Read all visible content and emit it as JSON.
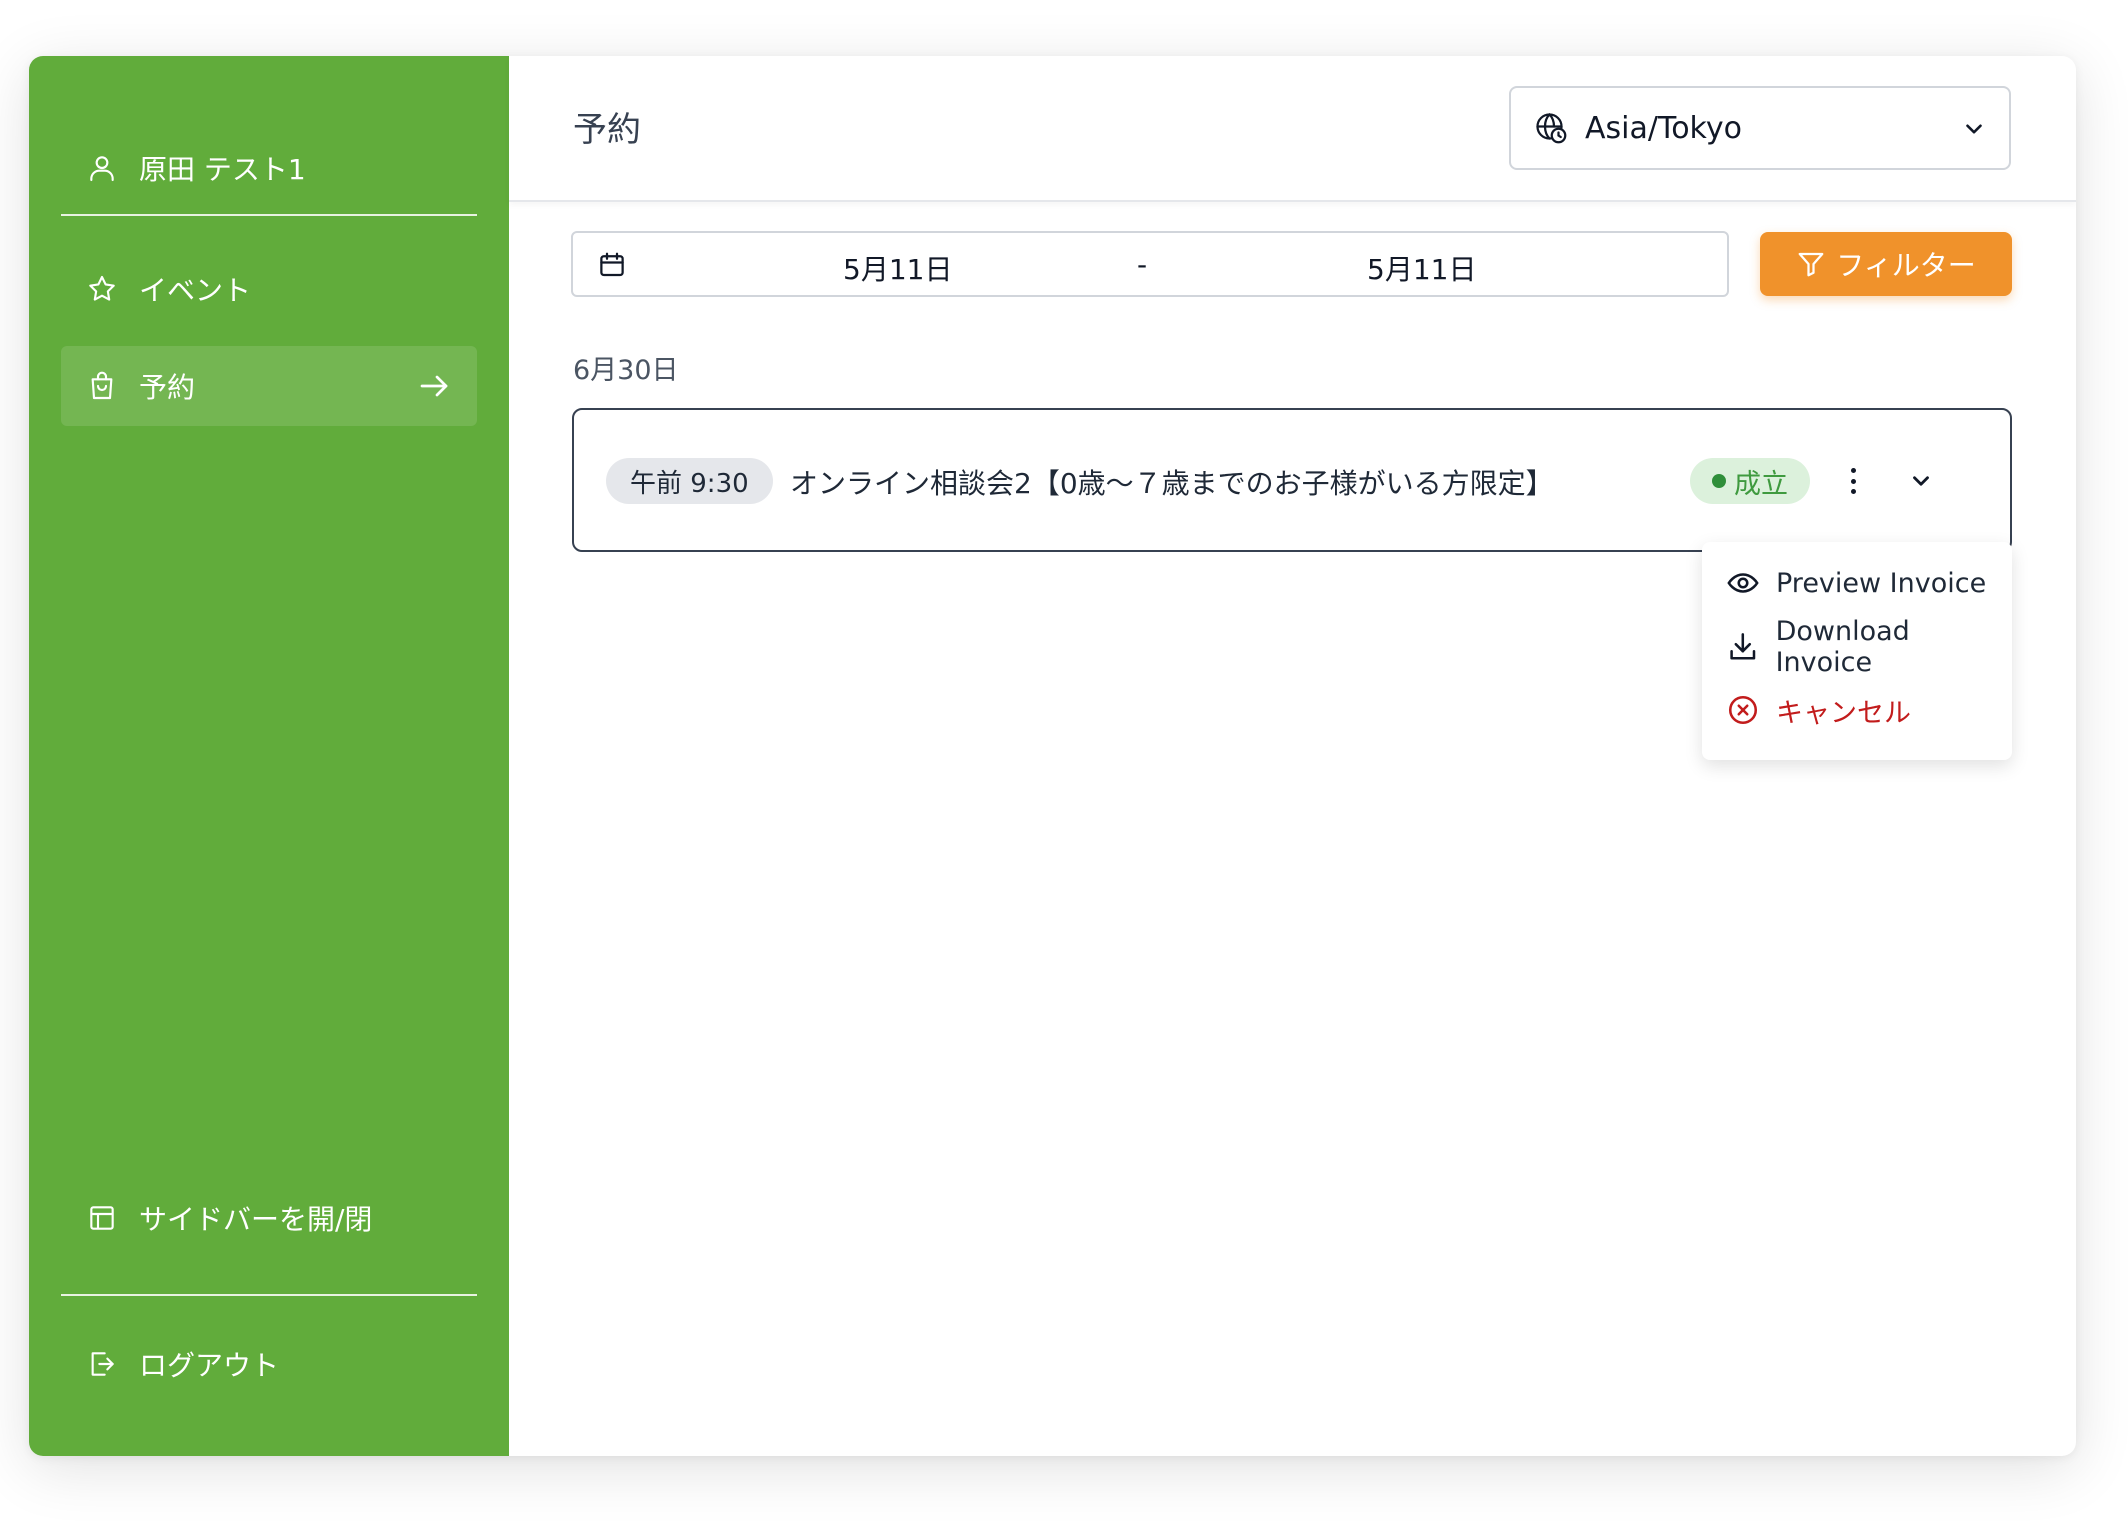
{
  "user": {
    "name": "原田 テスト1"
  },
  "sidebar": {
    "items": [
      {
        "label": "イベント",
        "icon": "star-icon"
      },
      {
        "label": "予約",
        "icon": "shopping-bag-icon",
        "active": true
      }
    ],
    "toggle_label": "サイドバーを開/閉",
    "logout_label": "ログアウト"
  },
  "header": {
    "title": "予約",
    "timezone": "Asia/Tokyo"
  },
  "filters": {
    "date_start": "5月11日",
    "date_separator": "-",
    "date_end": "5月11日",
    "filter_label": "フィルター"
  },
  "bookings": {
    "group_date": "6月30日",
    "items": [
      {
        "time": "午前 9:30",
        "title": "オンライン相談会2【0歳～７歳までのお子様がいる方限定】",
        "status": "成立"
      }
    ]
  },
  "menu": {
    "items": [
      {
        "label": "Preview Invoice",
        "icon": "eye-icon"
      },
      {
        "label": "Download Invoice",
        "icon": "download-icon"
      },
      {
        "label": "キャンセル",
        "icon": "cancel-circle-icon",
        "danger": true
      }
    ]
  },
  "colors": {
    "sidebar": "#61ac3b",
    "accent": "#f0922b",
    "status_bg": "#dcf1dc",
    "status_text": "#3f9a3f",
    "danger": "#c21c1c"
  }
}
